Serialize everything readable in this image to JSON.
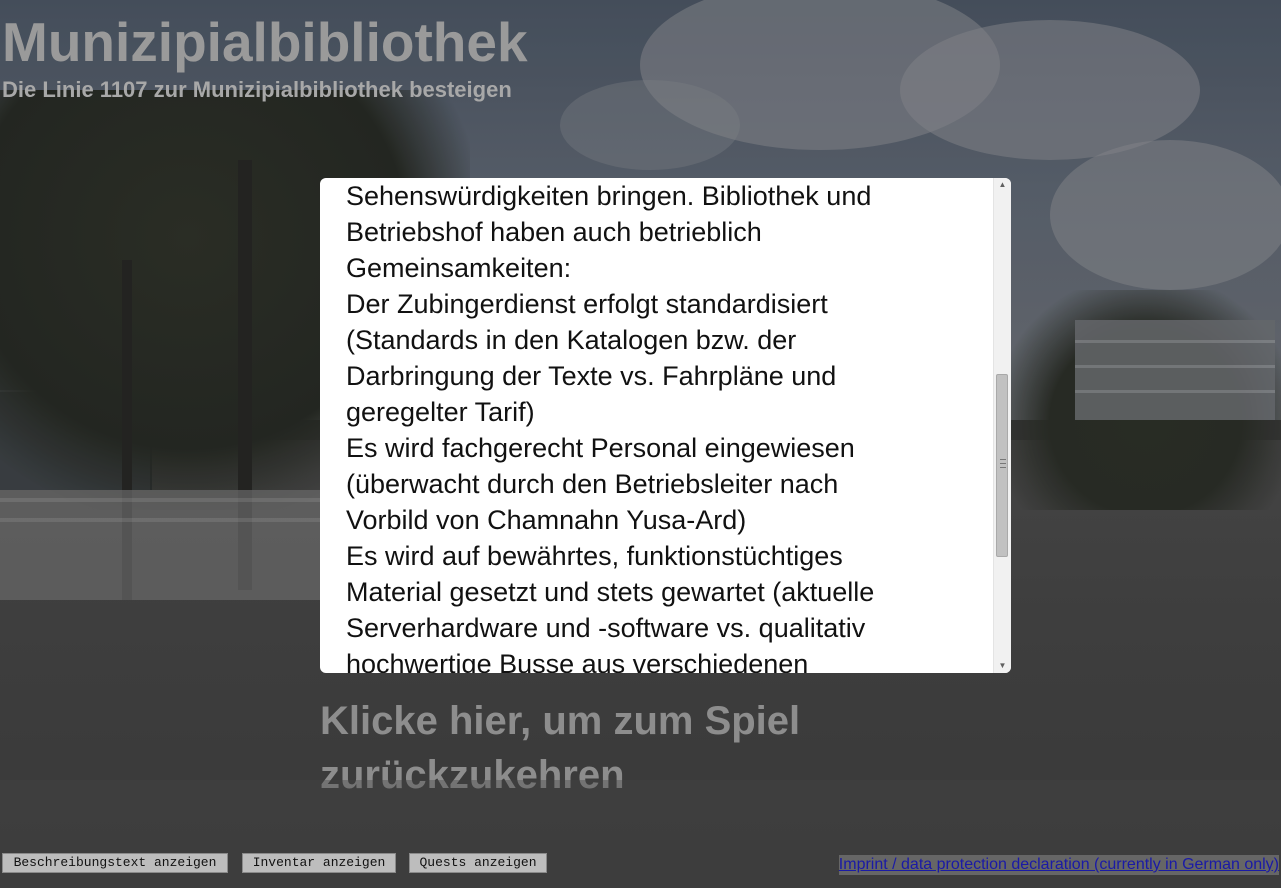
{
  "header": {
    "title": "Munizipialbibliothek",
    "subtitle": "Die Linie 1107 zur Munizipialbibliothek besteigen"
  },
  "dialog": {
    "lines": [
      "Sehenswürdigkeiten bringen. Bibliothek und",
      "Betriebshof haben auch betrieblich",
      "Gemeinsamkeiten:",
      "Der Zubingerdienst erfolgt standardisiert",
      "(Standards in den Katalogen bzw. der",
      "Darbringung der Texte vs. Fahrpläne und",
      "geregelter Tarif)",
      "Es wird fachgerecht Personal eingewiesen",
      "(überwacht durch den Betriebsleiter nach",
      "Vorbild von Chamnahn Yusa-Ard)",
      "Es wird auf bewährtes, funktionstüchtiges",
      "Material gesetzt und stets gewartet (aktuelle",
      "Serverhardware und -software vs. qualitativ",
      "hochwertige Busse aus verschiedenen"
    ],
    "scroll_up_icon": "▲",
    "scroll_down_icon": "▼"
  },
  "return_link": "Klicke hier, um zum Spiel zurückzukehren",
  "buttons": {
    "description": "Beschreibungstext anzeigen",
    "inventory": "Inventar anzeigen",
    "quests": "Quests anzeigen"
  },
  "imprint": "Imprint / data protection declaration (currently in German only)",
  "colors": {
    "title": "#9a9a9a",
    "link": "#1a1aa6",
    "dialog_bg": "#ffffff"
  }
}
